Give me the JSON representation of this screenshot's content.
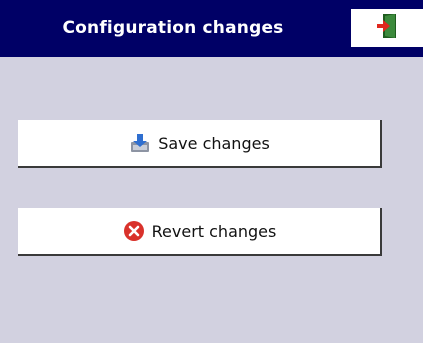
{
  "header": {
    "title": "Configuration changes",
    "exit_icon": "exit-door-icon"
  },
  "actions": {
    "save": {
      "label": "Save changes",
      "icon": "save-disk-icon"
    },
    "revert": {
      "label": "Revert changes",
      "icon": "close-circle-icon"
    }
  },
  "colors": {
    "header_bg": "#000066",
    "page_bg": "#d2d1e0",
    "button_bg": "#ffffff",
    "revert_icon": "#d9322b",
    "exit_icon_door": "#3c8a3c",
    "exit_icon_arrow": "#e0281e"
  }
}
